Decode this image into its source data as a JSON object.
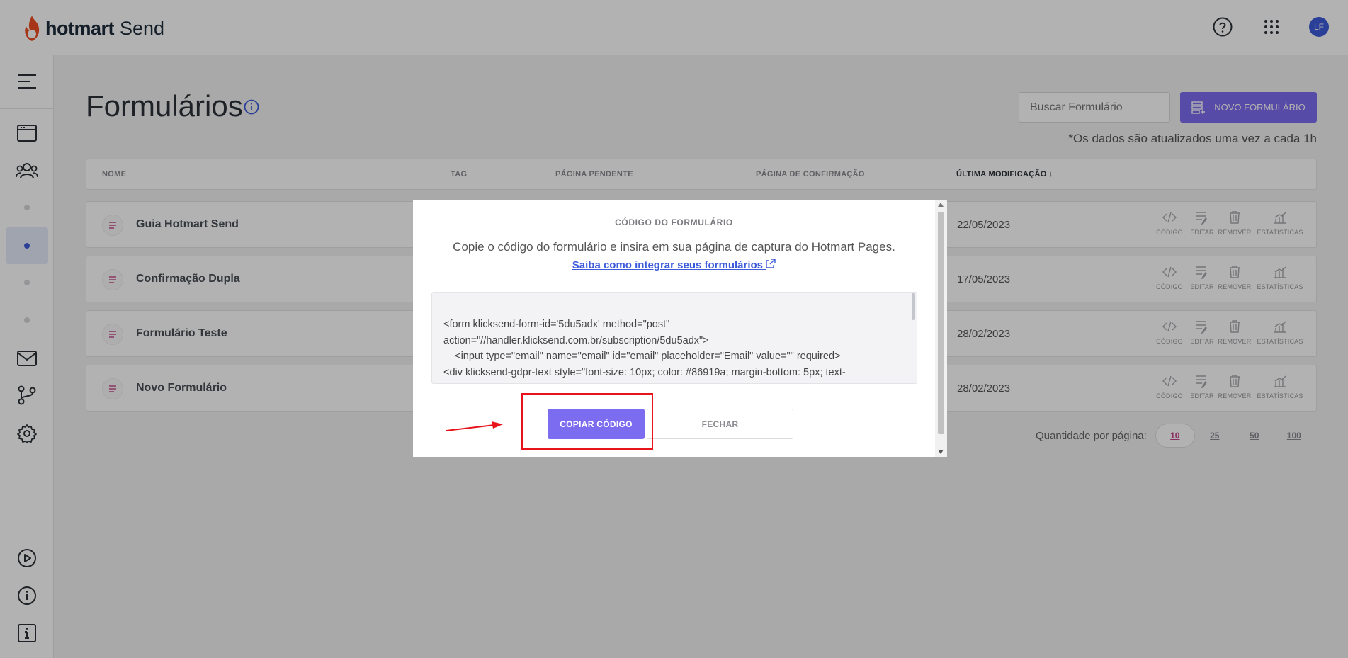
{
  "app": {
    "brand": "hotmart",
    "product": "Send",
    "avatar_initials": "LF",
    "accent_color": "#7b6cf0",
    "link_color": "#3d5bd9"
  },
  "header": {
    "icons": [
      "help-circle-icon",
      "apps-grid-icon"
    ]
  },
  "sidebar": {
    "items": [
      "menu-icon",
      "browser-window-icon",
      "users-icon",
      "dot",
      "dot-active",
      "dot",
      "dot",
      "mail-icon",
      "git-branch-icon",
      "gear-icon",
      "play-circle-icon",
      "info-circle-icon",
      "info-square-icon"
    ]
  },
  "page": {
    "title": "Formulários",
    "search_placeholder": "Buscar Formulário",
    "new_button": "NOVO FORMULÁRIO",
    "update_note": "*Os dados são atualizados uma vez a cada 1h"
  },
  "table": {
    "columns": [
      "NOME",
      "TAG",
      "PÁGINA PENDENTE",
      "PÁGINA DE CONFIRMAÇÃO",
      "ÚLTIMA MODIFICAÇÃO"
    ],
    "rows": [
      {
        "name": "Guia Hotmart Send",
        "date": "22/05/2023"
      },
      {
        "name": "Confirmação Dupla",
        "date": "17/05/2023"
      },
      {
        "name": "Formulário Teste",
        "date": "28/02/2023"
      },
      {
        "name": "Novo Formulário",
        "date": "28/02/2023"
      }
    ],
    "actions": [
      "CÓDIGO",
      "EDITAR",
      "REMOVER",
      "ESTATÍSTICAS"
    ]
  },
  "pagination": {
    "label": "Quantidade por página:",
    "options": [
      "10",
      "25",
      "50",
      "100"
    ],
    "selected": "10"
  },
  "modal": {
    "title": "CÓDIGO DO FORMULÁRIO",
    "description": "Copie o código do formulário e insira em sua página de captura do Hotmart Pages.",
    "link": "Saiba como integrar seus formulários",
    "code": "<form klicksend-form-id='5du5adx' method=\"post\"\naction=\"//handler.klicksend.com.br/subscription/5du5adx\">\n    <input type=\"email\" name=\"email\" id=\"email\" placeholder=\"Email\" value=\"\" required>\n<div klicksend-gdpr-text style=\"font-size: 10px; color: #86919a; margin-bottom: 5px; text-",
    "copy_button": "COPIAR CÓDIGO",
    "close_button": "FECHAR"
  }
}
